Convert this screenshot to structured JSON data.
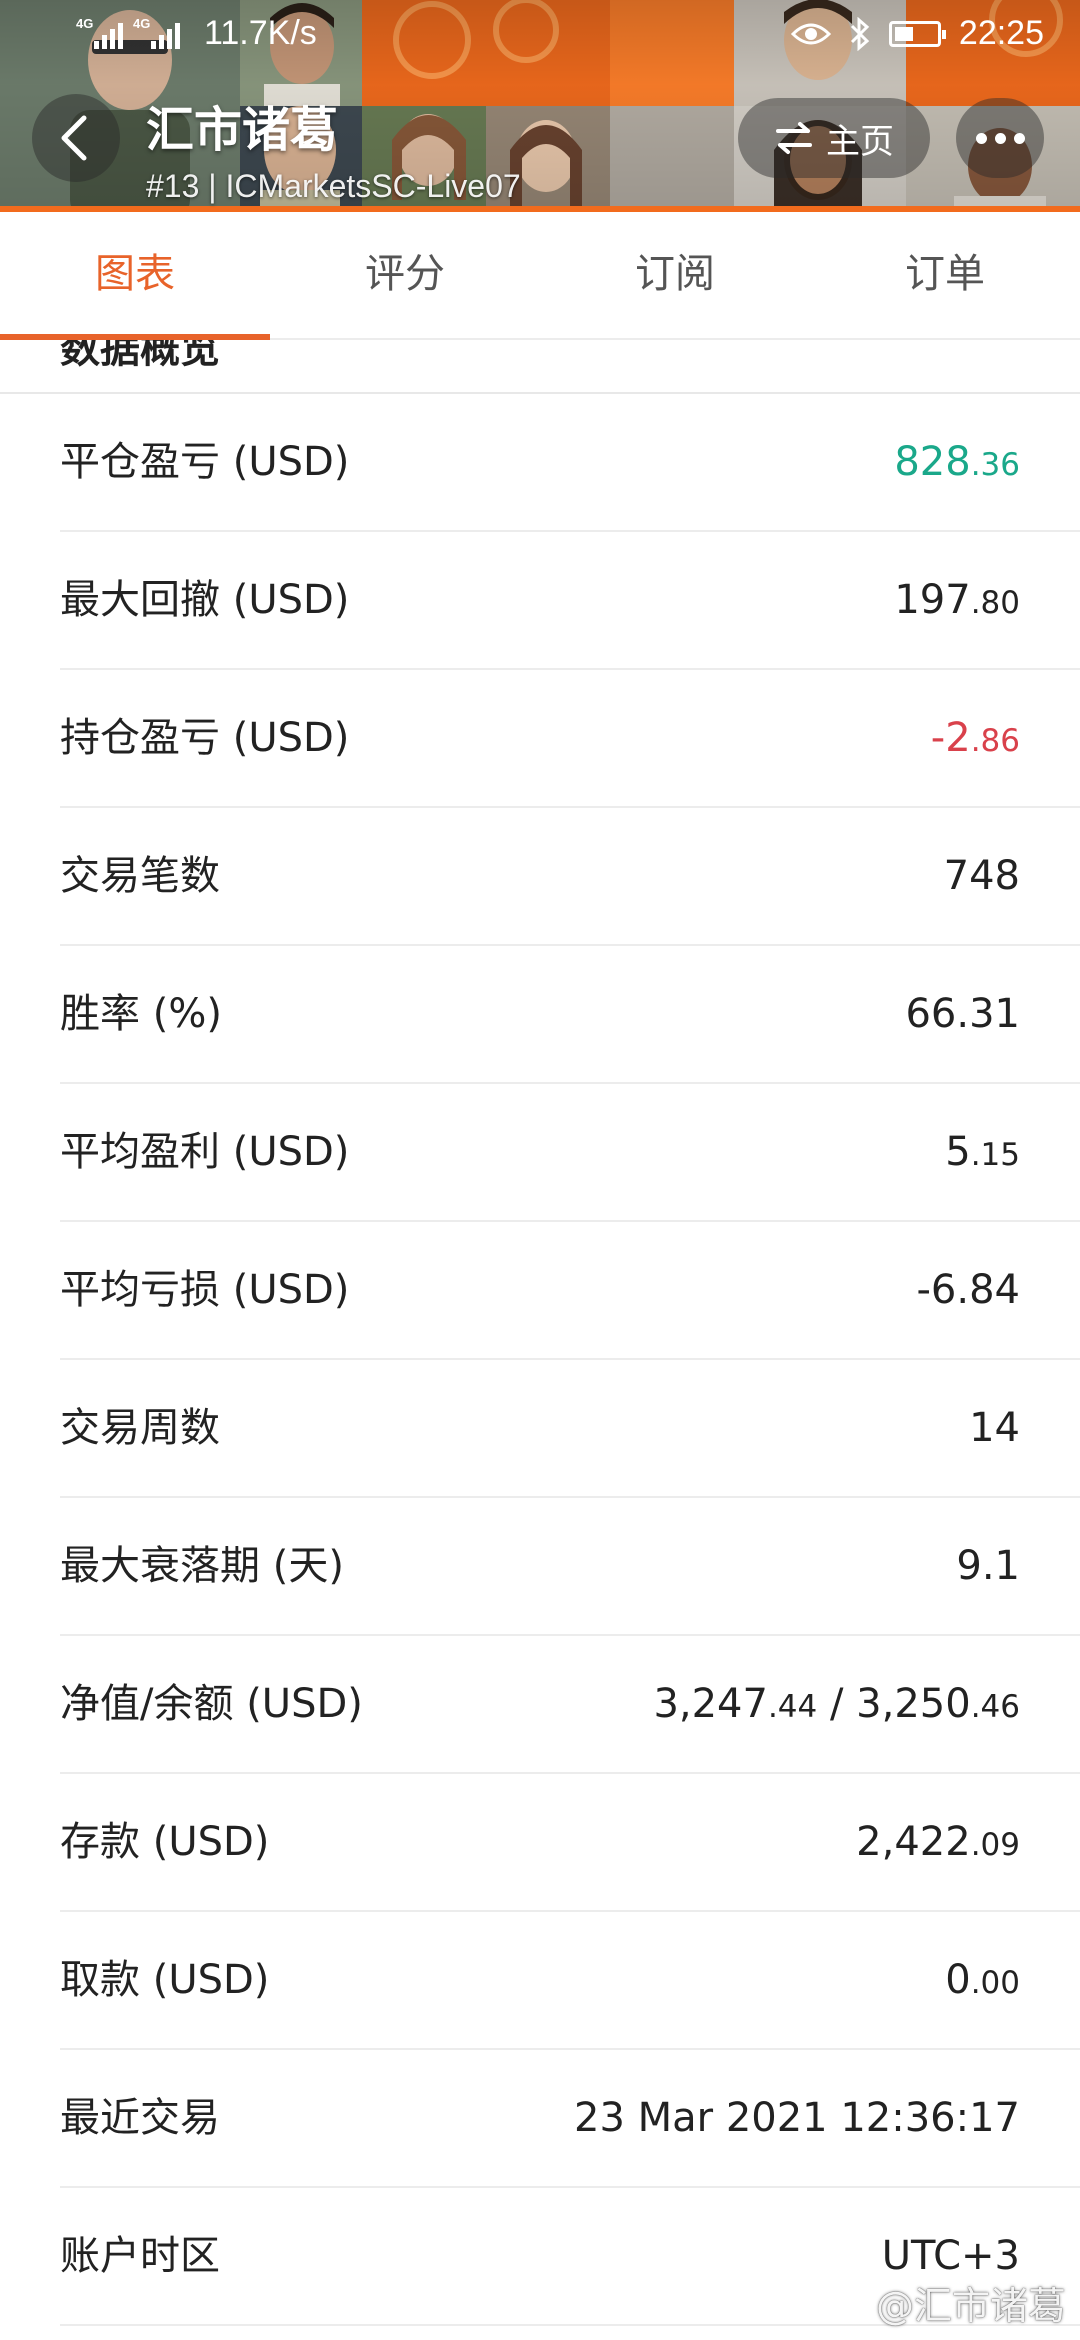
{
  "status_bar": {
    "signal_tag_1": "4G",
    "signal_tag_2": "4G",
    "net_speed": "11.7K/s",
    "time": "22:25"
  },
  "header": {
    "title": "汇市诸葛",
    "subtitle": "#13 | ICMarketsSC-Live07",
    "home_label": "主页",
    "accent_color": "#f26b1d"
  },
  "tabs": [
    {
      "label": "图表",
      "active": true
    },
    {
      "label": "评分",
      "active": false
    },
    {
      "label": "订阅",
      "active": false
    },
    {
      "label": "订单",
      "active": false
    }
  ],
  "section": {
    "title": "数据概览"
  },
  "stats": [
    {
      "label": "平仓盈亏 (USD)",
      "int": "828",
      "dec": ".36",
      "color": "green"
    },
    {
      "label": "最大回撤 (USD)",
      "int": "197",
      "dec": ".80",
      "color": "default"
    },
    {
      "label": "持仓盈亏 (USD)",
      "int": "-2",
      "dec": ".86",
      "color": "red"
    },
    {
      "label": "交易笔数",
      "int": "748",
      "dec": "",
      "color": "default"
    },
    {
      "label": "胜率 (%)",
      "int": "66.31",
      "dec": "",
      "color": "default"
    },
    {
      "label": "平均盈利 (USD)",
      "int": "5",
      "dec": ".15",
      "color": "default"
    },
    {
      "label": "平均亏损 (USD)",
      "int": "-6.84",
      "dec": "",
      "color": "default"
    },
    {
      "label": "交易周数",
      "int": "14",
      "dec": "",
      "color": "default"
    },
    {
      "label": "最大衰落期 (天)",
      "int": "9.1",
      "dec": "",
      "color": "default"
    },
    {
      "label": "净值/余额 (USD)",
      "int": "3,247",
      "dec": ".44",
      "int2": " / 3,250",
      "dec2": ".46",
      "color": "default"
    },
    {
      "label": "存款 (USD)",
      "int": "2,422",
      "dec": ".09",
      "color": "default"
    },
    {
      "label": "取款 (USD)",
      "int": "0",
      "dec": ".00",
      "color": "default"
    },
    {
      "label": "最近交易",
      "int": "23 Mar 2021 12:36:17",
      "dec": "",
      "color": "default"
    },
    {
      "label": "账户时区",
      "int": "UTC+3",
      "dec": "",
      "color": "default"
    }
  ],
  "watermark": {
    "text": "@汇市诸葛"
  }
}
